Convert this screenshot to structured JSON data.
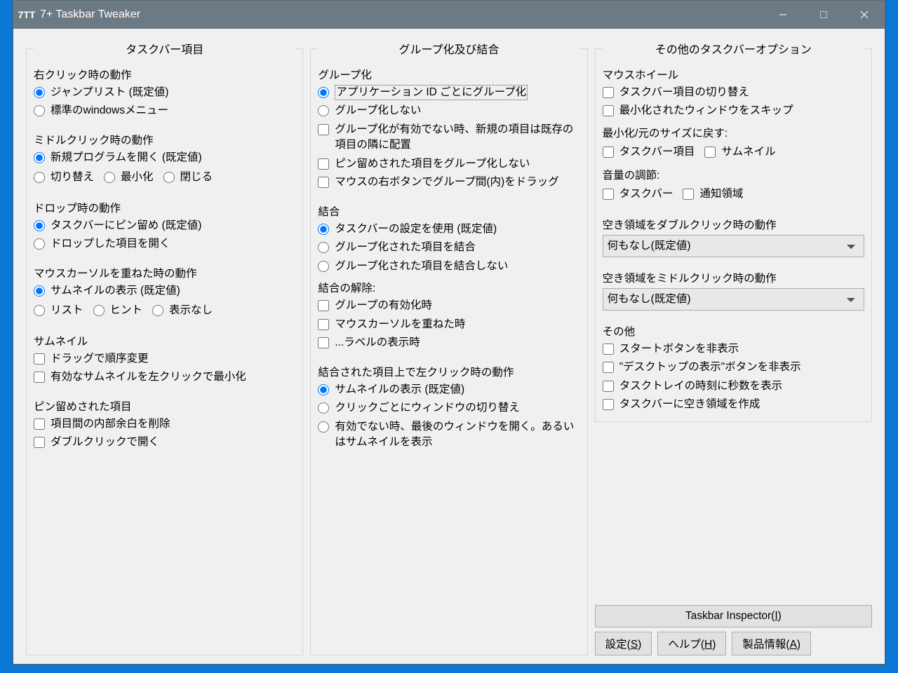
{
  "window": {
    "icon_text": "7TT",
    "title": "7+ Taskbar Tweaker"
  },
  "col1": {
    "heading": "タスクバー項目",
    "right_click": {
      "label": "右クリック時の動作",
      "opt1": "ジャンプリスト (既定値)",
      "opt2": "標準のwindowsメニュー"
    },
    "middle_click": {
      "label": "ミドルクリック時の動作",
      "opt1": "新規プログラムを開く (既定値)",
      "opt2": "切り替え",
      "opt3": "最小化",
      "opt4": "閉じる"
    },
    "drop": {
      "label": "ドロップ時の動作",
      "opt1": "タスクバーにピン留め (既定値)",
      "opt2": "ドロップした項目を開く"
    },
    "hover": {
      "label": "マウスカーソルを重ねた時の動作",
      "opt1": "サムネイルの表示 (既定値)",
      "opt2": "リスト",
      "opt3": "ヒント",
      "opt4": "表示なし"
    },
    "thumb": {
      "label": "サムネイル",
      "chk1": "ドラッグで順序変更",
      "chk2": "有効なサムネイルを左クリックで最小化"
    },
    "pinned": {
      "label": "ピン留めされた項目",
      "chk1": "項目間の内部余白を削除",
      "chk2": "ダブルクリックで開く"
    }
  },
  "col2": {
    "heading": "グループ化及び結合",
    "grouping": {
      "label": "グループ化",
      "opt1": "アプリケーション ID ごとにグループ化",
      "opt2": "グループ化しない",
      "chk1": "グループ化が有効でない時、新規の項目は既存の項目の隣に配置",
      "chk2": "ピン留めされた項目をグループ化しない",
      "chk3": "マウスの右ボタンでグループ間(内)をドラッグ"
    },
    "combine": {
      "label": "結合",
      "opt1": "タスクバーの設定を使用 (既定値)",
      "opt2": "グループ化された項目を結合",
      "opt3": "グループ化された項目を結合しない",
      "decombine_label": "結合の解除:",
      "dchk1": "グループの有効化時",
      "dchk2": "マウスカーソルを重ねた時",
      "dchk3": "...ラベルの表示時"
    },
    "leftclick": {
      "label": "結合された項目上で左クリック時の動作",
      "opt1": "サムネイルの表示 (既定値)",
      "opt2": "クリックごとにウィンドウの切り替え",
      "opt3": "有効でない時、最後のウィンドウを開く。あるいはサムネイルを表示"
    }
  },
  "col3": {
    "heading": "その他のタスクバーオプション",
    "wheel": {
      "label": "マウスホイール",
      "chk1": "タスクバー項目の切り替え",
      "chk1a": "最小化されたウィンドウをスキップ",
      "min_label": "最小化/元のサイズに戻す:",
      "mchk1": "タスクバー項目",
      "mchk2": "サムネイル",
      "vol_label": "音量の調節:",
      "vchk1": "タスクバー",
      "vchk2": "通知領域"
    },
    "dblclick": {
      "label": "空き領域をダブルクリック時の動作",
      "value": "何もなし(既定値)"
    },
    "midclick": {
      "label": "空き領域をミドルクリック時の動作",
      "value": "何もなし(既定値)"
    },
    "other": {
      "label": "その他",
      "chk1": "スタートボタンを非表示",
      "chk2": "\"デスクトップの表示\"ボタンを非表示",
      "chk3": "タスクトレイの時刻に秒数を表示",
      "chk4": "タスクバーに空き領域を作成"
    },
    "buttons": {
      "inspector_pre": "Taskbar Inspector(",
      "inspector_hot": "I",
      "inspector_post": ")",
      "settings_pre": "設定(",
      "settings_hot": "S",
      "settings_post": ")",
      "help_pre": "ヘルプ(",
      "help_hot": "H",
      "help_post": ")",
      "about_pre": "製品情報(",
      "about_hot": "A",
      "about_post": ")"
    }
  }
}
